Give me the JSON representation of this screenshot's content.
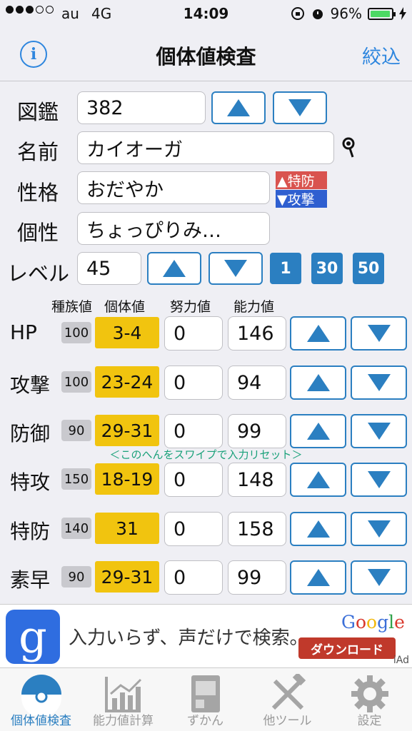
{
  "status_bar": {
    "carrier": "au",
    "network": "4G",
    "time": "14:09",
    "battery": "96%",
    "battery_level": 0.96
  },
  "nav": {
    "title": "個体値検査",
    "filter_label": "絞込",
    "info_label": "i"
  },
  "dex": {
    "label": "図鑑",
    "value": "382"
  },
  "name": {
    "label": "名前",
    "value": "カイオーガ"
  },
  "nature": {
    "label": "性格",
    "value": "おだやか",
    "up": "▲特防",
    "down": "▼攻撃",
    "up_color": "#d9534f",
    "down_color": "#2f5fd0"
  },
  "characteristic": {
    "label": "個性",
    "value": "ちょっぴりみ…"
  },
  "level": {
    "label": "レベル",
    "value": "45",
    "presets": [
      "1",
      "30",
      "50"
    ]
  },
  "columns": {
    "base": "種族値",
    "iv": "個体値",
    "ev": "努力値",
    "stat": "能力値"
  },
  "stats": [
    {
      "name": "HP",
      "base": "100",
      "iv": "3-4",
      "ev": "0",
      "value": "146"
    },
    {
      "name": "攻撃",
      "base": "100",
      "iv": "23-24",
      "ev": "0",
      "value": "94"
    },
    {
      "name": "防御",
      "base": "90",
      "iv": "29-31",
      "ev": "0",
      "value": "99"
    },
    {
      "name": "特攻",
      "base": "150",
      "iv": "18-19",
      "ev": "0",
      "value": "148"
    },
    {
      "name": "特防",
      "base": "140",
      "iv": "31",
      "ev": "0",
      "value": "158"
    },
    {
      "name": "素早",
      "base": "90",
      "iv": "29-31",
      "ev": "0",
      "value": "99"
    }
  ],
  "hint": "＜このへんをスワイプで入力リセット＞",
  "ad": {
    "icon_letter": "g",
    "text": "入力いらず、声だけで検索。",
    "brand": "Google",
    "button": "ダウンロード",
    "badge": "iAd"
  },
  "tabs": [
    {
      "label": "個体値検査",
      "icon": "pokeball-icon",
      "active": true
    },
    {
      "label": "能力値計算",
      "icon": "chart-icon",
      "active": false
    },
    {
      "label": "ずかん",
      "icon": "pokedex-icon",
      "active": false
    },
    {
      "label": "他ツール",
      "icon": "tools-icon",
      "active": false
    },
    {
      "label": "設定",
      "icon": "gear-icon",
      "active": false
    }
  ],
  "colors": {
    "accent": "#2b7fc1",
    "iv_highlight": "#f1c40f",
    "hint": "#1aa17a",
    "ad_button": "#c0392b"
  }
}
